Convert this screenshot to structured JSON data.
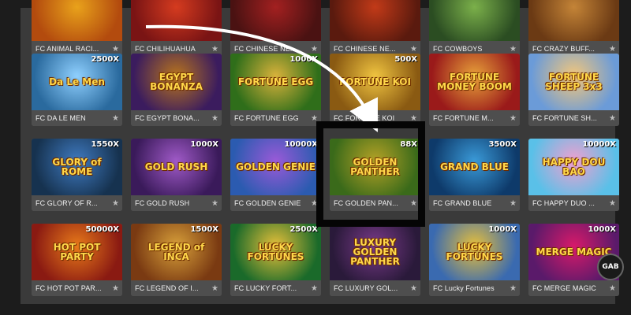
{
  "games": [
    {
      "name": "FC ANIMAL RACI...",
      "logo": "",
      "mult": ""
    },
    {
      "name": "FC CHILIHUAHUA",
      "logo": "",
      "mult": ""
    },
    {
      "name": "FC CHINESE NE...",
      "logo": "",
      "mult": ""
    },
    {
      "name": "FC CHINESE NE...",
      "logo": "",
      "mult": ""
    },
    {
      "name": "FC COWBOYS",
      "logo": "",
      "mult": ""
    },
    {
      "name": "FC CRAZY BUFF...",
      "logo": "",
      "mult": ""
    },
    {
      "name": "FC DA LE MEN",
      "logo": "Da Le Men",
      "mult": "2500X"
    },
    {
      "name": "FC EGYPT BONA...",
      "logo": "EGYPT BONANZA",
      "mult": ""
    },
    {
      "name": "FC FORTUNE EGG",
      "logo": "FORTUNE EGG",
      "mult": "1000X"
    },
    {
      "name": "FC FORTUNE KOI",
      "logo": "FORTUNE KOI",
      "mult": "500X"
    },
    {
      "name": "FC FORTUNE M...",
      "logo": "FORTUNE MONEY BOOM",
      "mult": ""
    },
    {
      "name": "FC FORTUNE SH...",
      "logo": "FORTUNE SHEEP 3x3",
      "mult": ""
    },
    {
      "name": "FC GLORY OF R...",
      "logo": "GLORY of ROME",
      "mult": "1550X"
    },
    {
      "name": "FC GOLD RUSH",
      "logo": "GOLD RUSH",
      "mult": "1000X"
    },
    {
      "name": "FC GOLDEN GENIE",
      "logo": "GOLDEN GENIE",
      "mult": "10000X"
    },
    {
      "name": "FC GOLDEN PAN...",
      "logo": "GOLDEN PANTHER",
      "mult": "88X"
    },
    {
      "name": "FC GRAND BLUE",
      "logo": "GRAND BLUE",
      "mult": "3500X"
    },
    {
      "name": "FC HAPPY DUO ...",
      "logo": "HAPPY DOU BAO",
      "mult": "10000X"
    },
    {
      "name": "FC HOT POT PAR...",
      "logo": "HOT POT PARTY",
      "mult": "50000X"
    },
    {
      "name": "FC LEGEND OF I...",
      "logo": "LEGEND of INCA",
      "mult": "1500X"
    },
    {
      "name": "FC LUCKY FORT...",
      "logo": "LUCKY FORTUNES",
      "mult": "2500X"
    },
    {
      "name": "FC LUXURY GOL...",
      "logo": "LUXURY GOLDEN PANTHER",
      "mult": ""
    },
    {
      "name": "FC Lucky Fortunes",
      "logo": "LUCKY FORTUNES",
      "mult": "1000X"
    },
    {
      "name": "FC MERGE MAGIC",
      "logo": "MERGE MAGIC",
      "mult": "1000X"
    }
  ],
  "badge": "GAB",
  "colors": {
    "background": "#3a3a3a",
    "caption": "#4e4e4e",
    "highlight": "#050505",
    "arrow": "#ffffff"
  }
}
